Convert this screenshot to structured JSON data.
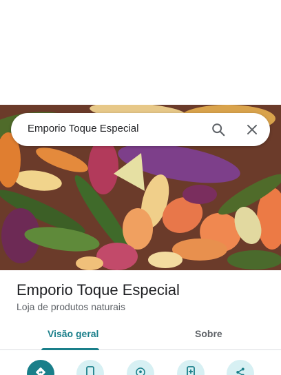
{
  "search": {
    "value": "Emporio Toque Especial"
  },
  "place": {
    "title": "Emporio Toque Especial",
    "category": "Loja de produtos naturais"
  },
  "tabs": [
    {
      "label": "Visão geral",
      "active": true
    },
    {
      "label": "Sobre",
      "active": false
    }
  ],
  "actions": [
    {
      "icon": "directions-icon",
      "primary": true
    },
    {
      "icon": "phone-icon",
      "primary": false
    },
    {
      "icon": "location-icon",
      "primary": false
    },
    {
      "icon": "save-to-phone-icon",
      "primary": false
    },
    {
      "icon": "share-icon",
      "primary": false
    }
  ],
  "colors": {
    "accent": "#1a7f8a",
    "accent_light": "#d7f0f3",
    "title": "#202124",
    "secondary_text": "#5f6368"
  }
}
